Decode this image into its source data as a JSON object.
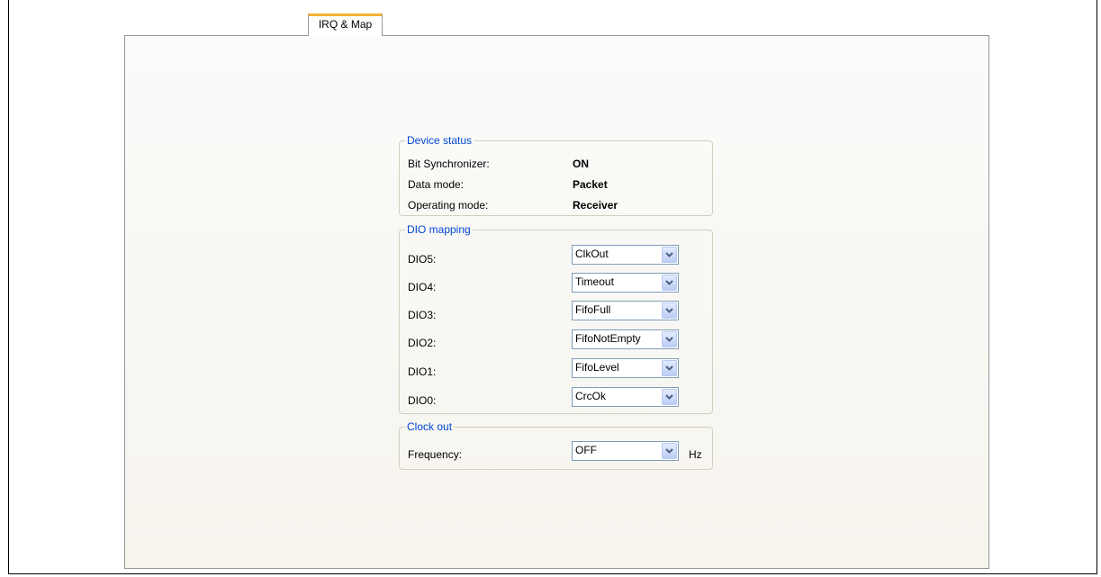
{
  "tabs": [
    {
      "label": "IRQ & Map",
      "active": true
    }
  ],
  "device_status": {
    "legend": "Device status",
    "rows": [
      {
        "label": "Bit Synchronizer:",
        "value": "ON"
      },
      {
        "label": "Data mode:",
        "value": "Packet"
      },
      {
        "label": "Operating mode:",
        "value": "Receiver"
      }
    ]
  },
  "dio_mapping": {
    "legend": "DIO mapping",
    "rows": [
      {
        "label": "DIO5:",
        "value": "ClkOut"
      },
      {
        "label": "DIO4:",
        "value": "Timeout"
      },
      {
        "label": "DIO3:",
        "value": "FifoFull"
      },
      {
        "label": "DIO2:",
        "value": "FifoNotEmpty"
      },
      {
        "label": "DIO1:",
        "value": "FifoLevel"
      },
      {
        "label": "DIO0:",
        "value": "CrcOk"
      }
    ]
  },
  "clock_out": {
    "legend": "Clock out",
    "frequency_label": "Frequency:",
    "frequency_value": "OFF",
    "unit": "Hz"
  },
  "colors": {
    "legend_text": "#0046d5",
    "tab_accent": "#f0b236",
    "group_border": "#d0d0bf",
    "combo_border": "#7f9db9"
  },
  "icons": {
    "dropdown": "chevron-down-icon"
  }
}
